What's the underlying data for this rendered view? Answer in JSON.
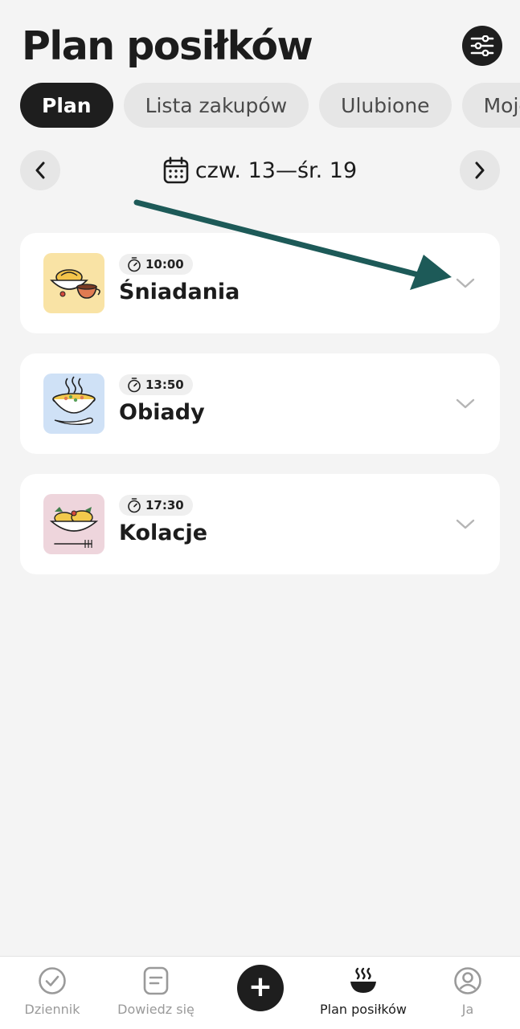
{
  "header": {
    "title": "Plan posiłków",
    "settings_icon": "sliders-icon"
  },
  "tabs": [
    {
      "label": "Plan",
      "active": true
    },
    {
      "label": "Lista zakupów",
      "active": false
    },
    {
      "label": "Ulubione",
      "active": false
    },
    {
      "label": "Moje",
      "active": false
    }
  ],
  "week": {
    "range": "czw. 13—śr. 19",
    "icon": "calendar-icon"
  },
  "meals": [
    {
      "name": "Śniadania",
      "time": "10:00",
      "thumb_bg": "#f9e3a5",
      "icon": "breakfast-icon"
    },
    {
      "name": "Obiady",
      "time": "13:50",
      "thumb_bg": "#cfe1f6",
      "icon": "soup-icon"
    },
    {
      "name": "Kolacje",
      "time": "17:30",
      "thumb_bg": "#eed5dc",
      "icon": "dinner-icon"
    }
  ],
  "bottom_nav": [
    {
      "label": "Dziennik",
      "icon": "check-circle-icon",
      "active": false
    },
    {
      "label": "Dowiedz się",
      "icon": "article-icon",
      "active": false
    },
    {
      "label": "Plan posiłków",
      "icon": "bowl-icon",
      "active": true
    },
    {
      "label": "Ja",
      "icon": "profile-icon",
      "active": false
    }
  ],
  "colors": {
    "accent_dark": "#1e1e1e",
    "annotation_arrow": "#1d5a58",
    "background": "#f4f4f4"
  }
}
